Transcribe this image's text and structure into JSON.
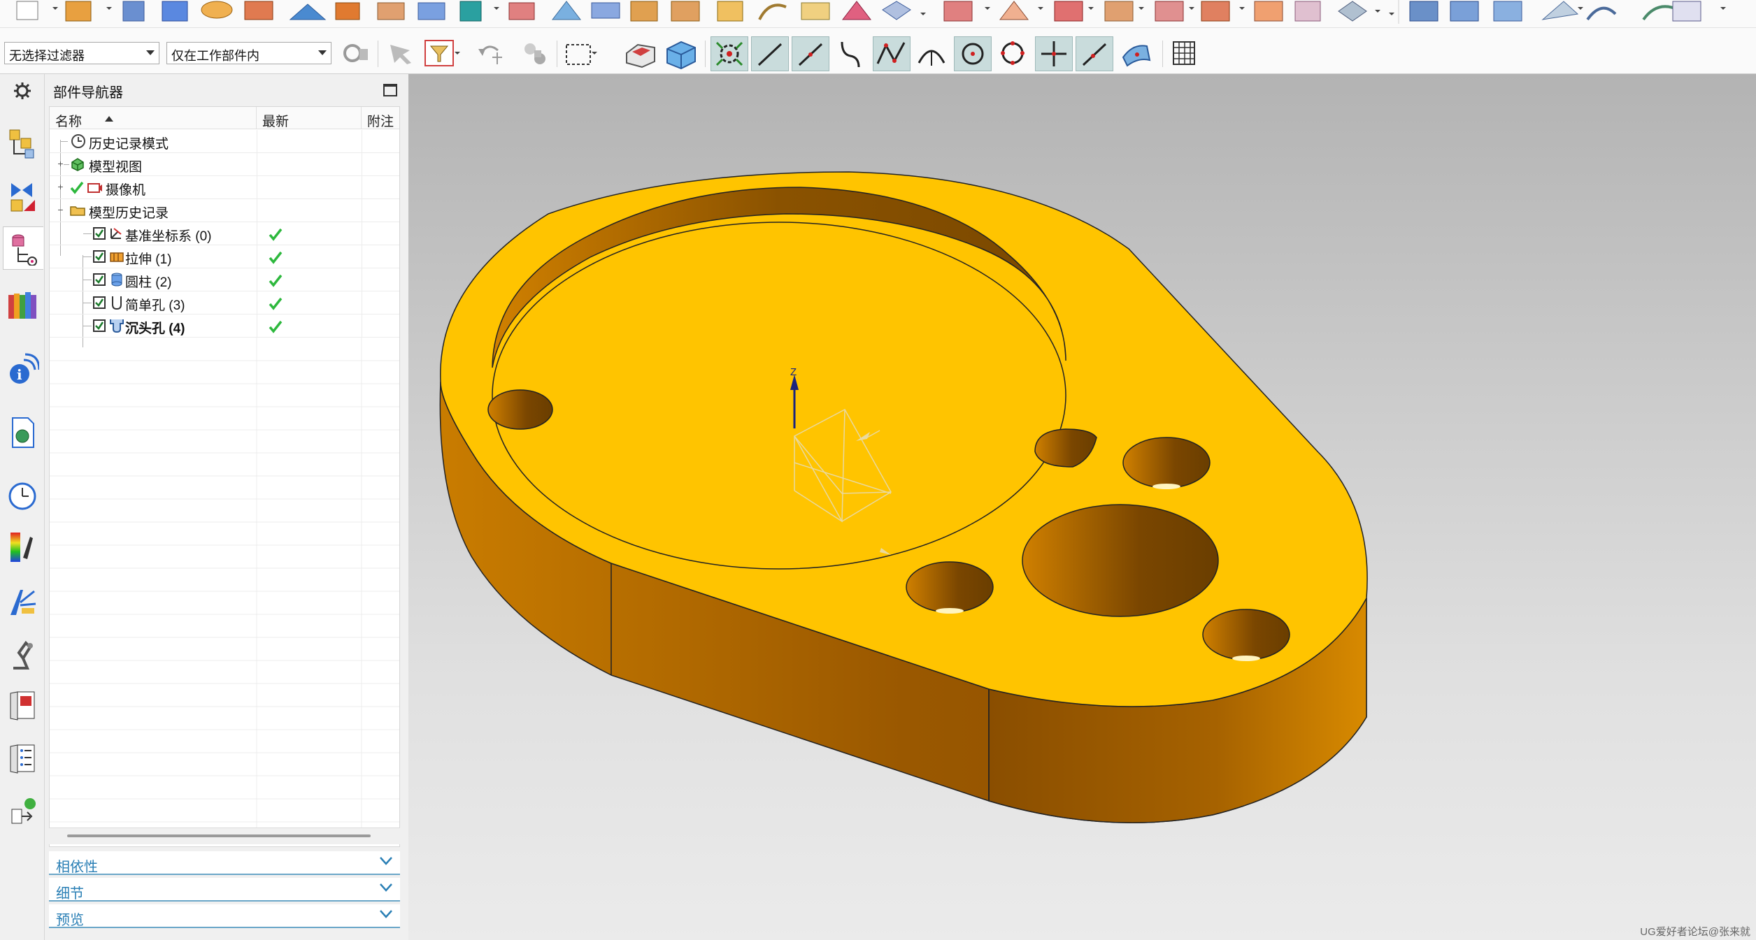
{
  "toolbar": {
    "filter_combo": "无选择过滤器",
    "scope_combo": "仅在工作部件内"
  },
  "navigator": {
    "title": "部件导航器",
    "columns": {
      "name": "名称",
      "latest": "最新",
      "attach": "附注"
    },
    "nodes": [
      {
        "label": "历史记录模式",
        "icon": "clock-icon",
        "checked": false
      },
      {
        "label": "模型视图",
        "icon": "model-view-icon",
        "checked": false
      },
      {
        "label": "摄像机",
        "icon": "camera-icon",
        "checked": false
      },
      {
        "label": "模型历史记录",
        "icon": "folder-icon",
        "checked": false
      },
      {
        "label": "基准坐标系 (0)",
        "icon": "datum-csys-icon",
        "checked": true,
        "up_to_date": true
      },
      {
        "label": "拉伸 (1)",
        "icon": "extrude-icon",
        "checked": true,
        "up_to_date": true
      },
      {
        "label": "圆柱 (2)",
        "icon": "cylinder-icon",
        "checked": true,
        "up_to_date": true
      },
      {
        "label": "简单孔 (3)",
        "icon": "simple-hole-icon",
        "checked": true,
        "up_to_date": true
      },
      {
        "label": "沉头孔 (4)",
        "icon": "counterbore-hole-icon",
        "checked": true,
        "up_to_date": true,
        "bold": true
      }
    ],
    "sections": [
      {
        "label": "相依性"
      },
      {
        "label": "细节"
      },
      {
        "label": "预览"
      }
    ]
  },
  "viewport": {
    "axis_label": "Z",
    "watermark": "UG爱好者论坛@张来就"
  },
  "colors": {
    "part_top": "#ffc400",
    "part_side": "#b86e00",
    "accent_blue": "#2a7fb5",
    "check_green": "#2db83d"
  }
}
